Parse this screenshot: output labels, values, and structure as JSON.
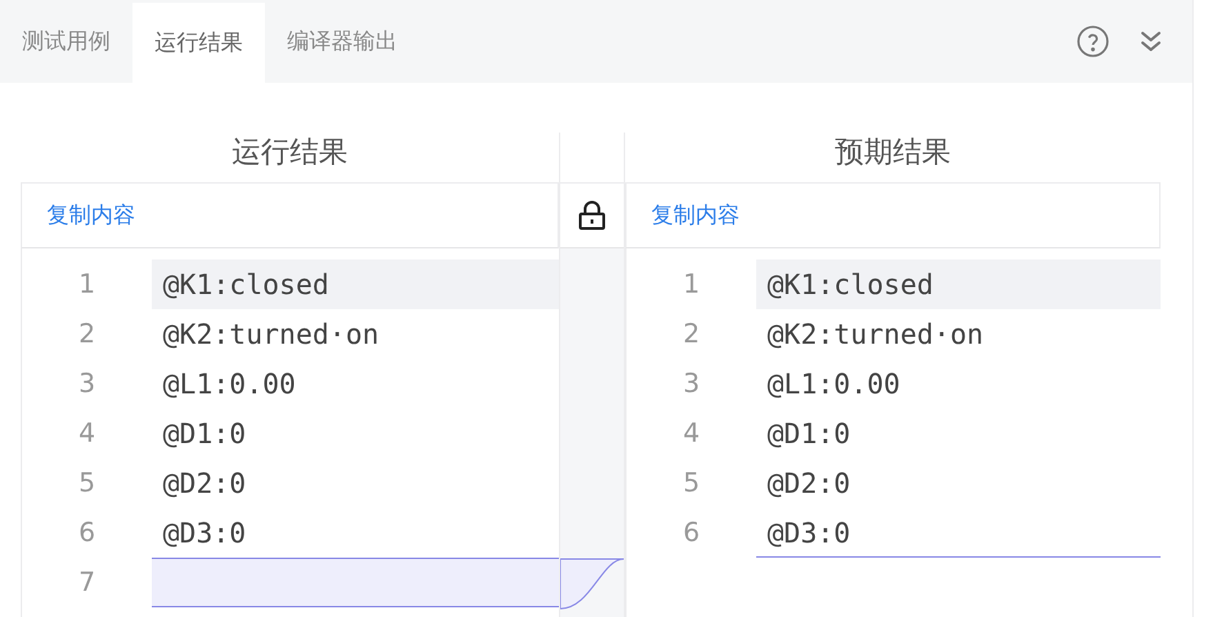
{
  "tabs": [
    {
      "label": "测试用例",
      "selected": false
    },
    {
      "label": "运行结果",
      "selected": true
    },
    {
      "label": "编译器输出",
      "selected": false
    }
  ],
  "panes": [
    {
      "title": "运行结果",
      "copy_label": "复制内容",
      "lines": [
        {
          "number": "1",
          "text": "@K1:closed",
          "current": true,
          "kind": "same"
        },
        {
          "number": "2",
          "text": "@K2:turned·on",
          "current": false,
          "kind": "same"
        },
        {
          "number": "3",
          "text": "@L1:0.00",
          "current": false,
          "kind": "same"
        },
        {
          "number": "4",
          "text": "@D1:0",
          "current": false,
          "kind": "same"
        },
        {
          "number": "5",
          "text": "@D2:0",
          "current": false,
          "kind": "same"
        },
        {
          "number": "6",
          "text": "@D3:0",
          "current": false,
          "kind": "same"
        },
        {
          "number": "7",
          "current": false,
          "kind": "added"
        }
      ]
    },
    {
      "title": "预期结果",
      "copy_label": "复制内容",
      "lines": [
        {
          "number": "1",
          "text": "@K1:closed",
          "current": true,
          "kind": "same"
        },
        {
          "number": "2",
          "text": "@K2:turned·on",
          "current": false,
          "kind": "same"
        },
        {
          "number": "3",
          "text": "@L1:0.00",
          "current": false,
          "kind": "same"
        },
        {
          "number": "4",
          "text": "@D1:0",
          "current": false,
          "kind": "same"
        },
        {
          "number": "5",
          "text": "@D2:0",
          "current": false,
          "kind": "same"
        },
        {
          "number": "6",
          "text": "@D3:0",
          "current": false,
          "kind": "gap_below"
        }
      ]
    }
  ]
}
